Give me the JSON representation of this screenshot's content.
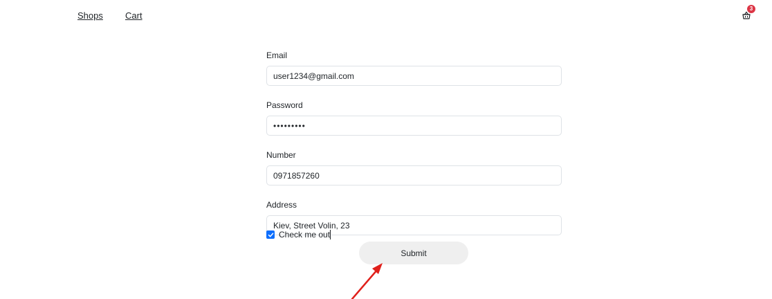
{
  "nav": {
    "shops_label": "Shops",
    "cart_label": "Cart",
    "cart_badge_count": "3"
  },
  "form": {
    "email": {
      "label": "Email",
      "value": "user1234@gmail.com"
    },
    "password": {
      "label": "Password",
      "value": "•••••••••"
    },
    "number": {
      "label": "Number",
      "value": "0971857260"
    },
    "address": {
      "label": "Address",
      "value": "Kiev, Street Volin, 23"
    },
    "checkbox": {
      "label": "Check me out",
      "checked": true
    },
    "submit_label": "Submit"
  },
  "colors": {
    "badge": "#dc3545",
    "checkbox": "#0d6efd",
    "arrow": "#e0201b",
    "button_bg": "#efefef"
  },
  "icons": {
    "cart": "shopping-basket-icon",
    "check": "checkmark-icon",
    "annotation": "red-arrow-icon"
  }
}
